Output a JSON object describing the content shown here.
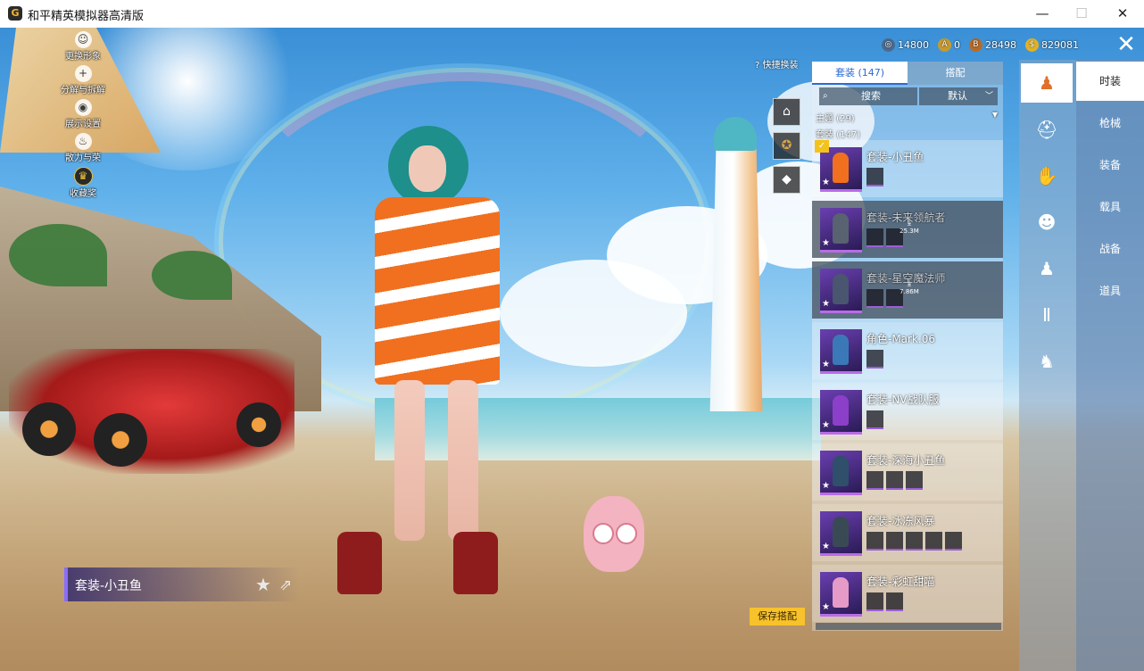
{
  "window": {
    "title": "和平精英模拟器高清版",
    "logo_letter": "G",
    "minimize": "—",
    "maximize": "☐",
    "close": "✕"
  },
  "left_menu": [
    {
      "label": "更换形象",
      "icon": "person-icon",
      "glyph": "☺"
    },
    {
      "label": "分解与拆解",
      "icon": "plus-icon",
      "glyph": "+"
    },
    {
      "label": "展示设置",
      "icon": "eye-icon",
      "glyph": "◉"
    },
    {
      "label": "散力与荣",
      "icon": "flame-icon",
      "glyph": "♨"
    },
    {
      "label": "收藏奖",
      "icon": "crown-icon",
      "glyph": "♛"
    }
  ],
  "quick_swap": {
    "label": "快捷换装",
    "help": "?",
    "icons": [
      {
        "icon": "locker-icon",
        "glyph": "⌂"
      },
      {
        "icon": "medal-icon",
        "glyph": "✪"
      },
      {
        "icon": "diamond-icon",
        "glyph": "◆"
      }
    ]
  },
  "currency": [
    {
      "icon": "globe-coin-icon",
      "glyph": "◎",
      "value": "14800",
      "color": "#4a6b8f"
    },
    {
      "icon": "a-coin-icon",
      "glyph": "A",
      "value": "0",
      "color": "#c79a2e"
    },
    {
      "icon": "b-coin-icon",
      "glyph": "B",
      "value": "28498",
      "color": "#b56b2a"
    },
    {
      "icon": "gold-coin-icon",
      "glyph": "$",
      "value": "829081",
      "color": "#e0b224"
    }
  ],
  "close_button": "✕",
  "panel": {
    "tabs": [
      {
        "label": "套装 (147)",
        "active": true
      },
      {
        "label": "搭配",
        "active": false
      }
    ],
    "search": {
      "icon": "⌕",
      "label": "搜索"
    },
    "sort": {
      "label": "默认",
      "chevron": "﹀"
    },
    "theme": {
      "label": "主题 (29)",
      "chevron": "▼"
    },
    "section": "套装 (147)",
    "items": [
      {
        "name": "套装-小丑鱼",
        "state": "selected",
        "check": "✓",
        "parts": 1,
        "fig": "#f07020",
        "download": ""
      },
      {
        "name": "套装-未来领航者",
        "state": "dim",
        "parts": 2,
        "fig": "#586270",
        "download": "25.3M"
      },
      {
        "name": "套装-星空魔法师",
        "state": "dim",
        "parts": 2,
        "fig": "#4a5570",
        "download": "7.86M"
      },
      {
        "name": "角色-Mark.06",
        "state": "normal",
        "parts": 1,
        "fig": "#3b78b8",
        "download": ""
      },
      {
        "name": "套装-NV战队服",
        "state": "normal",
        "parts": 1,
        "fig": "#8c3fc8",
        "download": ""
      },
      {
        "name": "套装-深海小丑鱼",
        "state": "normal",
        "parts": 3,
        "fig": "#2f4f6a",
        "download": ""
      },
      {
        "name": "套装-冰冻风暴",
        "state": "normal",
        "parts": 5,
        "fig": "#3a4a55",
        "download": ""
      },
      {
        "name": "套装-彩虹甜喵",
        "state": "normal",
        "parts": 2,
        "fig": "#e59ac8",
        "download": ""
      }
    ]
  },
  "save_button": "保存搭配",
  "outfit_label": "套装-小丑鱼",
  "fav_icon": "★",
  "share_icon": "⇗",
  "slots": [
    {
      "icon": "outfit-slot-icon",
      "glyph": "♟",
      "active": true
    },
    {
      "icon": "hat-slot-icon",
      "glyph": "⛑",
      "active": false
    },
    {
      "icon": "gloves-slot-icon",
      "glyph": "✋",
      "active": false
    },
    {
      "icon": "mask-slot-icon",
      "glyph": "☻",
      "active": false
    },
    {
      "icon": "top-slot-icon",
      "glyph": "♟",
      "active": false
    },
    {
      "icon": "pants-slot-icon",
      "glyph": "Ⅱ",
      "active": false
    },
    {
      "icon": "shoes-slot-icon",
      "glyph": "♞",
      "active": false
    }
  ],
  "categories": [
    {
      "label": "时装",
      "active": true
    },
    {
      "label": "枪械",
      "active": false
    },
    {
      "label": "装备",
      "active": false
    },
    {
      "label": "载具",
      "active": false
    },
    {
      "label": "战备",
      "active": false
    },
    {
      "label": "道具",
      "active": false
    }
  ]
}
